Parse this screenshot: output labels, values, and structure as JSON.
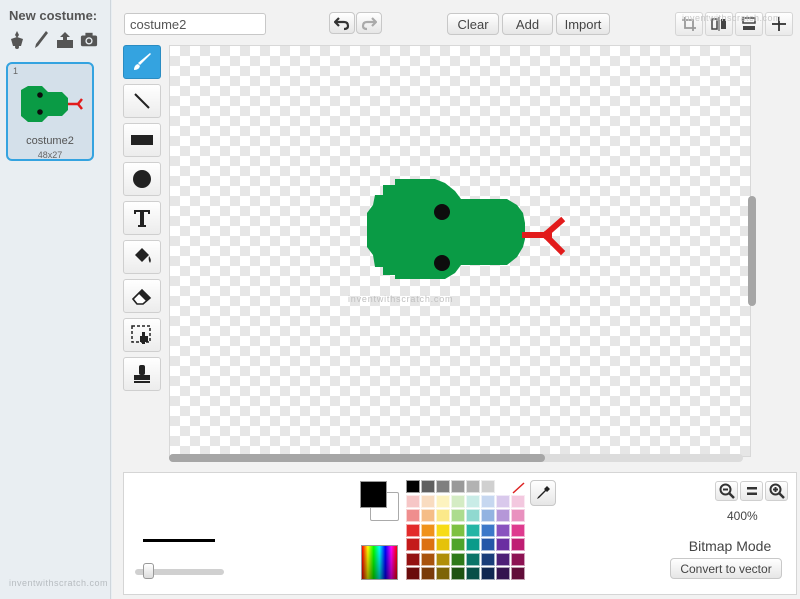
{
  "sidebar": {
    "new_costume_label": "New costume:",
    "tools": [
      "paint-from-library-icon",
      "paintbrush-icon",
      "upload-icon",
      "camera-icon"
    ],
    "costume": {
      "number": "1",
      "name": "costume2",
      "size": "48x27"
    },
    "watermark": "inventwithscratch.com"
  },
  "toolbar": {
    "costume_name_value": "costume2",
    "clear_label": "Clear",
    "add_label": "Add",
    "import_label": "Import",
    "watermark": "inventwithscratch.com"
  },
  "paint_tools": [
    "brush",
    "line",
    "rectangle",
    "ellipse",
    "text",
    "fill",
    "eraser",
    "select",
    "stamp"
  ],
  "canvas": {
    "watermark": "inventwithscratch.com",
    "sprite_colors": {
      "body": "#0a9b45",
      "eyes": "#0d0d0d",
      "tongue": "#e21b1b"
    }
  },
  "bottom": {
    "primary_color": "#000000",
    "secondary_color": "#ffffff",
    "palette": [
      "#000000",
      "#5f5f5f",
      "#7f7f7f",
      "#999999",
      "#b2b2b2",
      "#d0d0d0",
      "#ffffff",
      "transparent",
      "#f6c6c6",
      "#f9dcc0",
      "#fdf3bf",
      "#d4ecc4",
      "#c9ece7",
      "#c6d7f0",
      "#d9c9ec",
      "#f3c8df",
      "#ef8e8e",
      "#f5bd87",
      "#fbe98a",
      "#acdc8e",
      "#90d9d0",
      "#93b3e1",
      "#b597d8",
      "#e991bf",
      "#e32b2b",
      "#f0921b",
      "#f7dc17",
      "#7dc142",
      "#24b5a5",
      "#3c78c9",
      "#8a52bf",
      "#de3b8f",
      "#c41a1a",
      "#dc7112",
      "#e5c20a",
      "#4ea42b",
      "#0a9b8a",
      "#2456a8",
      "#6a2ea1",
      "#bf1e73",
      "#941212",
      "#a9530c",
      "#b08f08",
      "#2e7a1a",
      "#0a7468",
      "#193d7a",
      "#4d1f77",
      "#8d1353",
      "#6a0c0c",
      "#7a3b08",
      "#7d6506",
      "#1e5312",
      "#074f47",
      "#0f2752",
      "#34134f",
      "#610d39"
    ],
    "zoom_level": "400%",
    "mode_label": "Bitmap Mode",
    "convert_label": "Convert to vector",
    "brush_size": 0.1
  }
}
